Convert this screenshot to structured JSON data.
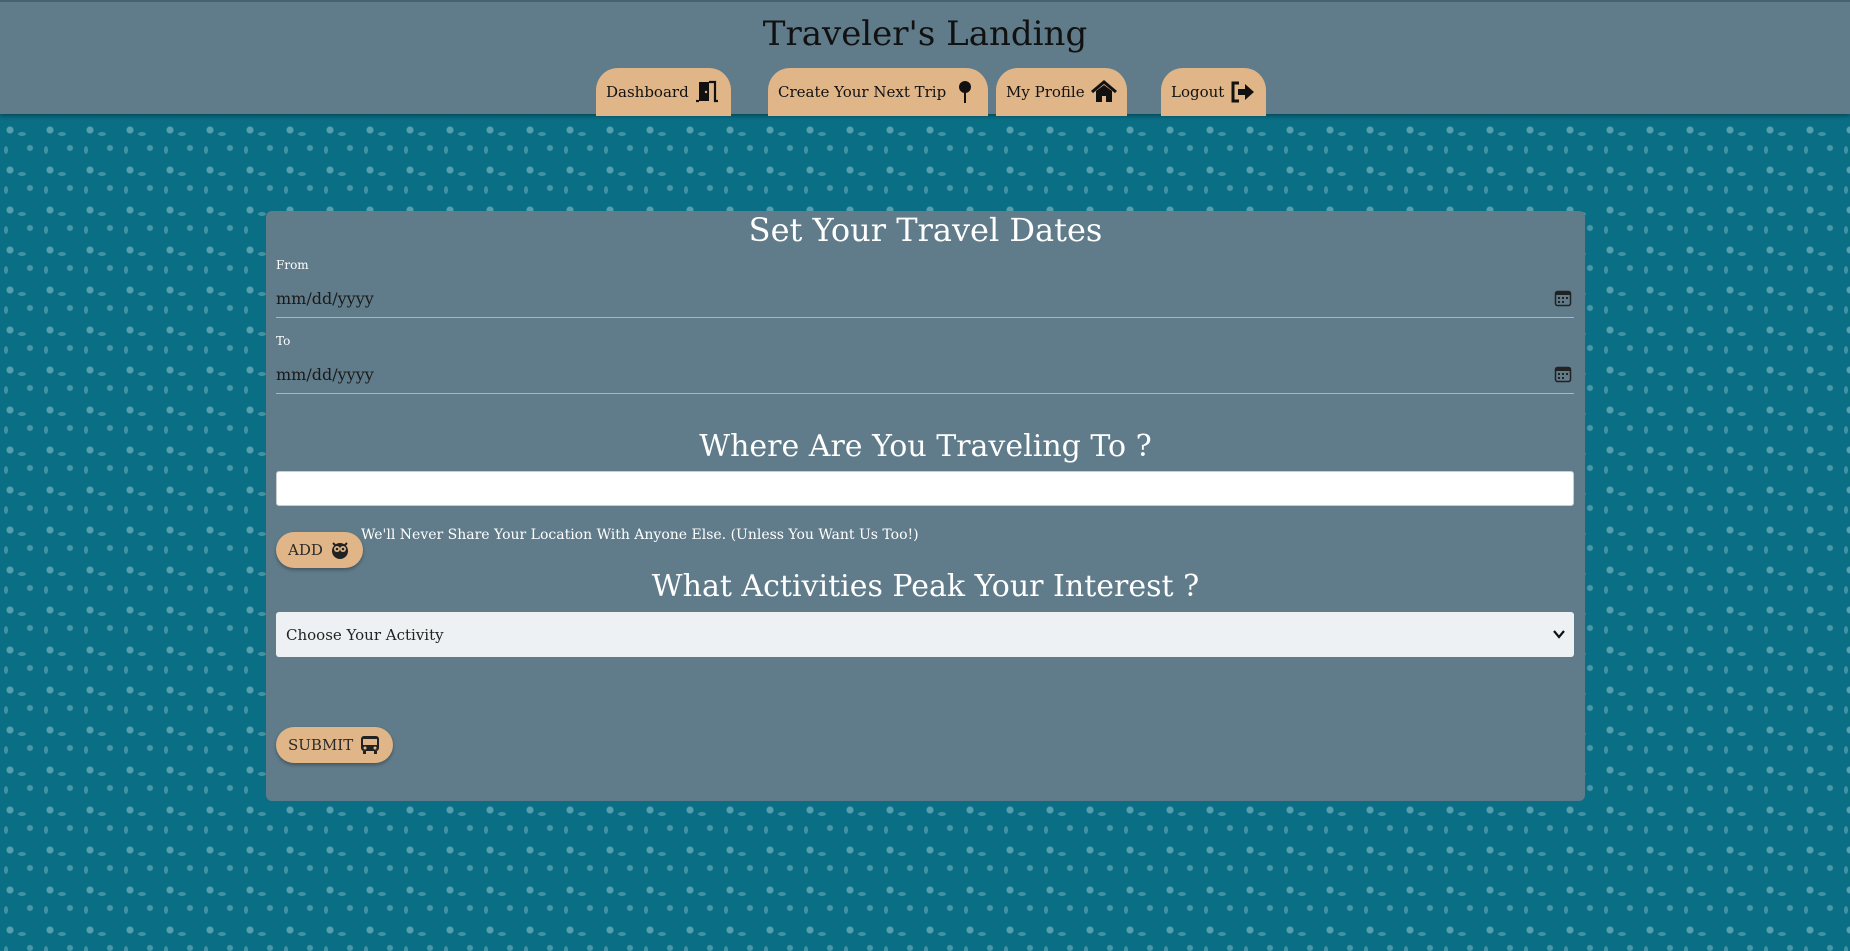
{
  "header": {
    "title": "Traveler's Landing"
  },
  "nav": [
    {
      "label": "Dashboard",
      "icon": "door-open-icon"
    },
    {
      "label": "Create Your Next Trip",
      "icon": "map-pin-icon"
    },
    {
      "label": "My Profile",
      "icon": "home-icon"
    },
    {
      "label": "Logout",
      "icon": "sign-out-icon"
    }
  ],
  "form": {
    "dates_heading": "Set Your Travel Dates",
    "from_label": "From",
    "from_placeholder": "mm/dd/yyyy",
    "to_label": "To",
    "to_placeholder": "mm/dd/yyyy",
    "destination_heading": "Where Are You Traveling To ?",
    "destination_value": "",
    "add_label": "ADD",
    "privacy_note": "We'll Never Share Your Location With Anyone Else. (Unless You Want Us Too!)",
    "activities_heading": "What Activities Peak Your Interest ?",
    "activity_selected": "Choose Your Activity",
    "submit_label": "SUBMIT"
  },
  "colors": {
    "header_bg": "#607b89",
    "page_bg": "#0a6e85",
    "nav_tab": "#e0b688",
    "card_bg": "#607b89"
  }
}
